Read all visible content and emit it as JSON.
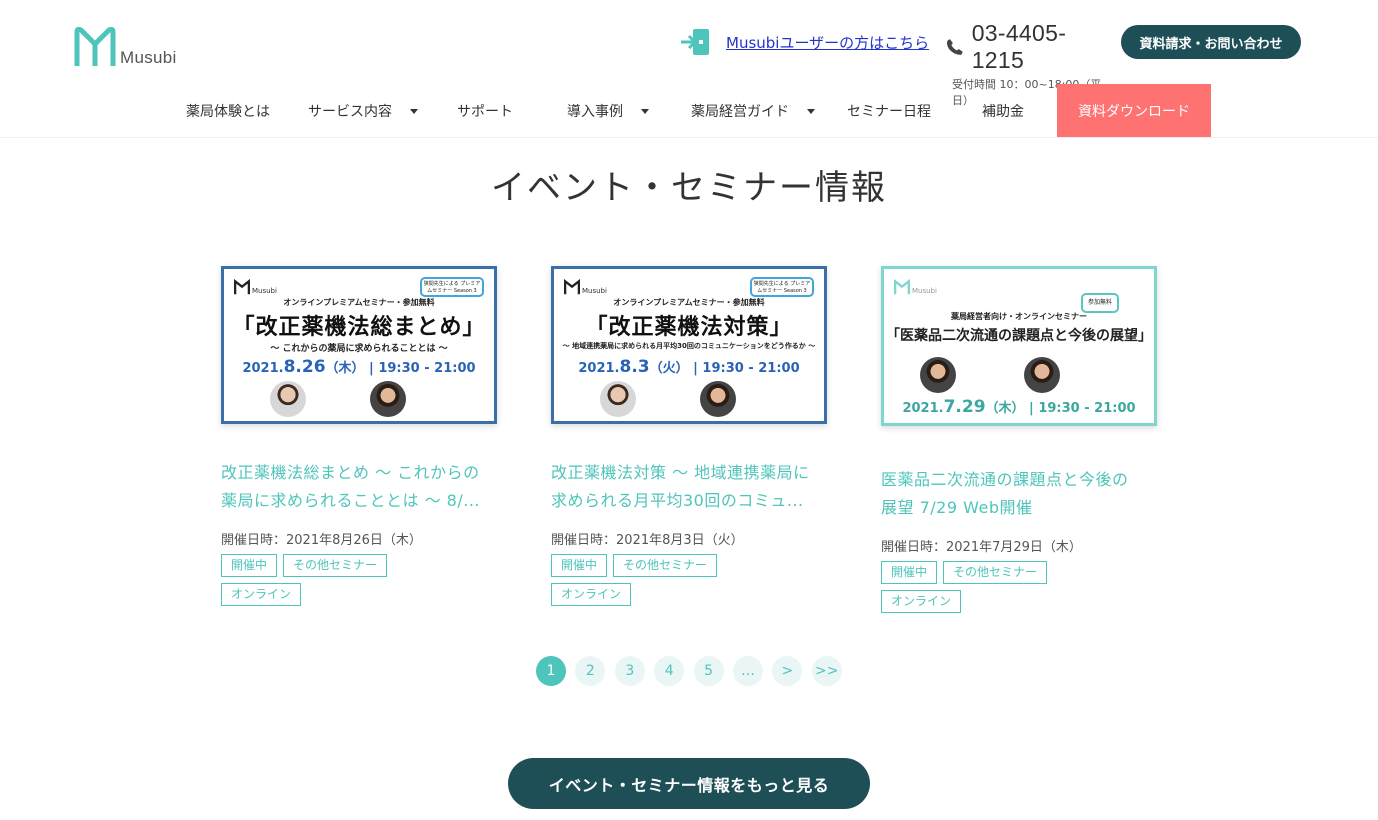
{
  "header": {
    "logo_text": "Musubi",
    "user_link": "Musubiユーザーの方はこちら",
    "phone": "03-4405-1215",
    "hours": "受付時間 10：00~18:00（平日）",
    "contact_button": "資料請求・お問い合わせ"
  },
  "nav": {
    "items": [
      {
        "label": "薬局体験とは"
      },
      {
        "label": "サービス内容"
      },
      {
        "label": "サポート"
      },
      {
        "label": "導入事例"
      },
      {
        "label": "薬局経営ガイド"
      },
      {
        "label": "セミナー日程"
      },
      {
        "label": "補助金"
      }
    ],
    "download": "資料ダウンロード"
  },
  "section_title": "イベント・セミナー情報",
  "cards": [
    {
      "thumb": {
        "logo": "Musubi",
        "sub": "オンラインプレミアムセミナー・参加無料",
        "bubble": "狭間先生による プレミアムセミナー Season 3",
        "big": "「改正薬機法総まとめ」",
        "caption": "〜 これからの薬局に求められることとは 〜",
        "date_prefix": "2021.",
        "date_big": "8.26",
        "date_suffix": "（木） | 19:30 - 21:00"
      },
      "title_line1": "改正薬機法総まとめ 〜 これからの",
      "title_line2": "薬局に求められることとは 〜 8/...",
      "date": "開催日時：2021年8月26日（木）",
      "tags": [
        "開催中",
        "その他セミナー",
        "オンライン"
      ]
    },
    {
      "thumb": {
        "logo": "Musubi",
        "sub": "オンラインプレミアムセミナー・参加無料",
        "bubble": "狭間先生による プレミアムセミナー Season 3",
        "big": "「改正薬機法対策」",
        "caption": "〜 地域連携薬局に求められる月平均30回のコミュニケーションをどう作るか 〜",
        "date_prefix": "2021.",
        "date_big": "8.3",
        "date_suffix": "（火） | 19:30 - 21:00"
      },
      "title_line1": "改正薬機法対策 〜 地域連携薬局に",
      "title_line2": "求められる月平均30回のコミュ...",
      "date": "開催日時：2021年8月3日（火）",
      "tags": [
        "開催中",
        "その他セミナー",
        "オンライン"
      ]
    },
    {
      "thumb": {
        "logo": "Musubi",
        "badge": "参加無料",
        "sub": "薬局経営者向け・オンラインセミナー",
        "big": "「医薬品二次流通の課題点と今後の展望」",
        "date_prefix": "2021.",
        "date_big": "7.29",
        "date_suffix": "（木） | 19:30 - 21:00"
      },
      "title_line1": "医薬品二次流通の課題点と今後の",
      "title_line2": "展望 7/29 Web開催",
      "date": "開催日時：2021年7月29日（木）",
      "tags": [
        "開催中",
        "その他セミナー",
        "オンライン"
      ]
    }
  ],
  "pagination": [
    "1",
    "2",
    "3",
    "4",
    "5",
    "…",
    ">",
    ">>"
  ],
  "more_button": "イベント・セミナー情報をもっと見る",
  "colors": {
    "accent": "#4ec5bb",
    "dark": "#1e4f57",
    "download": "#ff7272",
    "link": "#2233cc"
  }
}
